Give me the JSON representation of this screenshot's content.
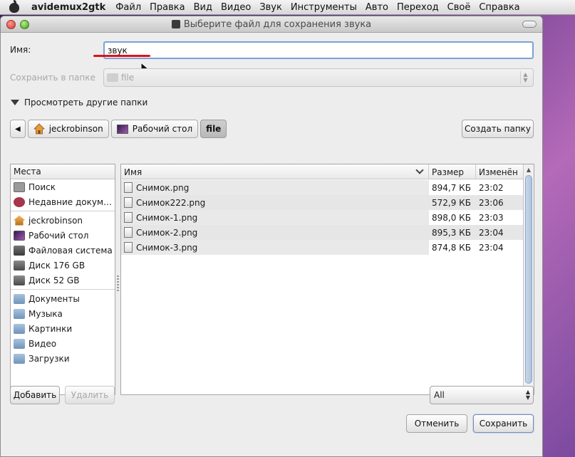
{
  "menubar": {
    "app_name": "avidemux2gtk",
    "items": [
      "Файл",
      "Правка",
      "Вид",
      "Видео",
      "Звук",
      "Инструменты",
      "Авто",
      "Переход",
      "Своё",
      "Справка"
    ]
  },
  "dialog": {
    "title": "Выберите файл для сохранения звука",
    "name_label": "Имя:",
    "name_value": "звук",
    "save_in_label": "Сохранить в папке",
    "save_in_value": "file",
    "browse_label": "Просмотреть другие папки"
  },
  "pathbar": {
    "items": [
      "jeckrobinson",
      "Рабочий стол",
      "file"
    ],
    "create_folder": "Создать папку"
  },
  "places": {
    "header": "Места",
    "items": [
      {
        "label": "Поиск",
        "icon": "search-icon"
      },
      {
        "label": "Недавние докум…",
        "icon": "recent-icon"
      },
      {
        "label": "jeckrobinson",
        "icon": "home-icon"
      },
      {
        "label": "Рабочий стол",
        "icon": "desktop-icon"
      },
      {
        "label": "Файловая система",
        "icon": "filesystem-icon"
      },
      {
        "label": "Диск 176 GB",
        "icon": "disk-icon"
      },
      {
        "label": "Диск 52 GB",
        "icon": "disk-icon"
      },
      {
        "label": "Документы",
        "icon": "folder-icon"
      },
      {
        "label": "Музыка",
        "icon": "folder-icon"
      },
      {
        "label": "Картинки",
        "icon": "folder-icon"
      },
      {
        "label": "Видео",
        "icon": "folder-icon"
      },
      {
        "label": "Загрузки",
        "icon": "folder-icon"
      }
    ]
  },
  "files": {
    "columns": {
      "name": "Имя",
      "size": "Размер",
      "modified": "Изменён"
    },
    "rows": [
      {
        "name": "Снимок.png",
        "size": "894,7 КБ",
        "modified": "23:02"
      },
      {
        "name": "Снимок222.png",
        "size": "572,9 КБ",
        "modified": "23:06"
      },
      {
        "name": "Снимок-1.png",
        "size": "898,0 КБ",
        "modified": "23:03"
      },
      {
        "name": "Снимок-2.png",
        "size": "895,3 КБ",
        "modified": "23:04"
      },
      {
        "name": "Снимок-3.png",
        "size": "874,8 КБ",
        "modified": "23:04"
      }
    ]
  },
  "bottom": {
    "add_label": "Добавить",
    "remove_label": "Удалить",
    "filter_value": "All",
    "cancel_label": "Отменить",
    "save_label": "Сохранить"
  }
}
